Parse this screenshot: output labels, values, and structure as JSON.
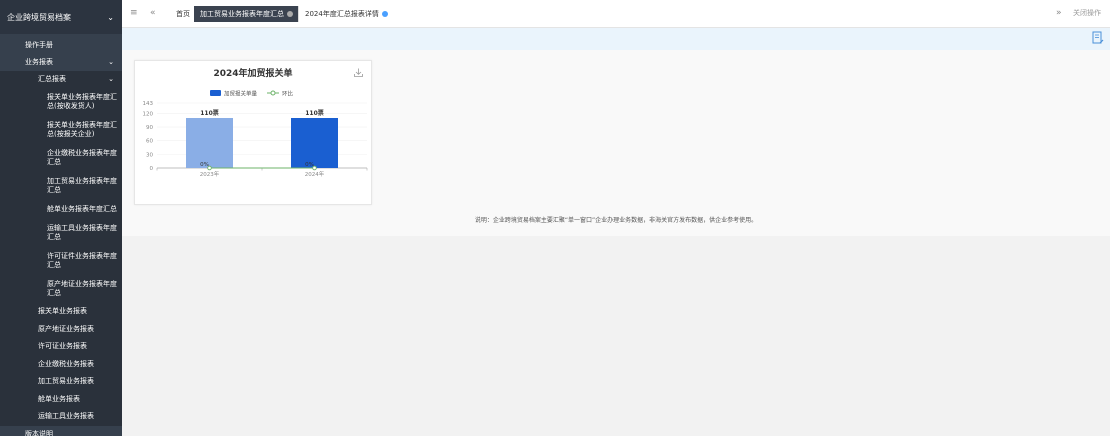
{
  "sidebar": {
    "header": "企业跨境贸易档案",
    "manual": "操作手册",
    "business": "业务报表",
    "summary": "汇总报表",
    "leaves": [
      "报关单业务报表年度汇总(按收发货人)",
      "报关单业务报表年度汇总(按报关企业)",
      "企业缴税业务报表年度汇总",
      "加工贸易业务报表年度汇总",
      "舱单业务报表年度汇总",
      "运输工具业务报表年度汇总",
      "许可证件业务报表年度汇总",
      "原产地证业务报表年度汇总"
    ],
    "level2": [
      "报关单业务报表",
      "原产地证业务报表",
      "许可证业务报表",
      "企业缴税业务报表",
      "加工贸易业务报表",
      "舱单业务报表",
      "运输工具业务报表"
    ],
    "version": "版本说明"
  },
  "topbar": {
    "home": "首页",
    "tab1": "加工贸易业务报表年度汇总",
    "tab2": "2024年度汇总报表详情",
    "close_ops": "关闭操作"
  },
  "chart_data": {
    "type": "bar",
    "title": "2024年加贸报关单",
    "categories": [
      "2023年",
      "2024年"
    ],
    "series": [
      {
        "name": "加贸报关单量",
        "values": [
          110,
          110
        ],
        "colors": [
          "#8aaee6",
          "#1a5fd1"
        ],
        "labels": [
          "110票",
          "110票"
        ]
      },
      {
        "name": "环比",
        "type": "line",
        "values": [
          0,
          0
        ],
        "labels": [
          "0%",
          "0%"
        ],
        "color": "#6db36a"
      }
    ],
    "yticks": [
      143,
      120,
      90,
      60,
      30,
      0
    ],
    "ylim": [
      0,
      143
    ]
  },
  "note": "说明：企业跨境贸易档案主要汇聚“单一窗口”企业办理业务数据，非海关官方发布数据，供企业参考使用。"
}
